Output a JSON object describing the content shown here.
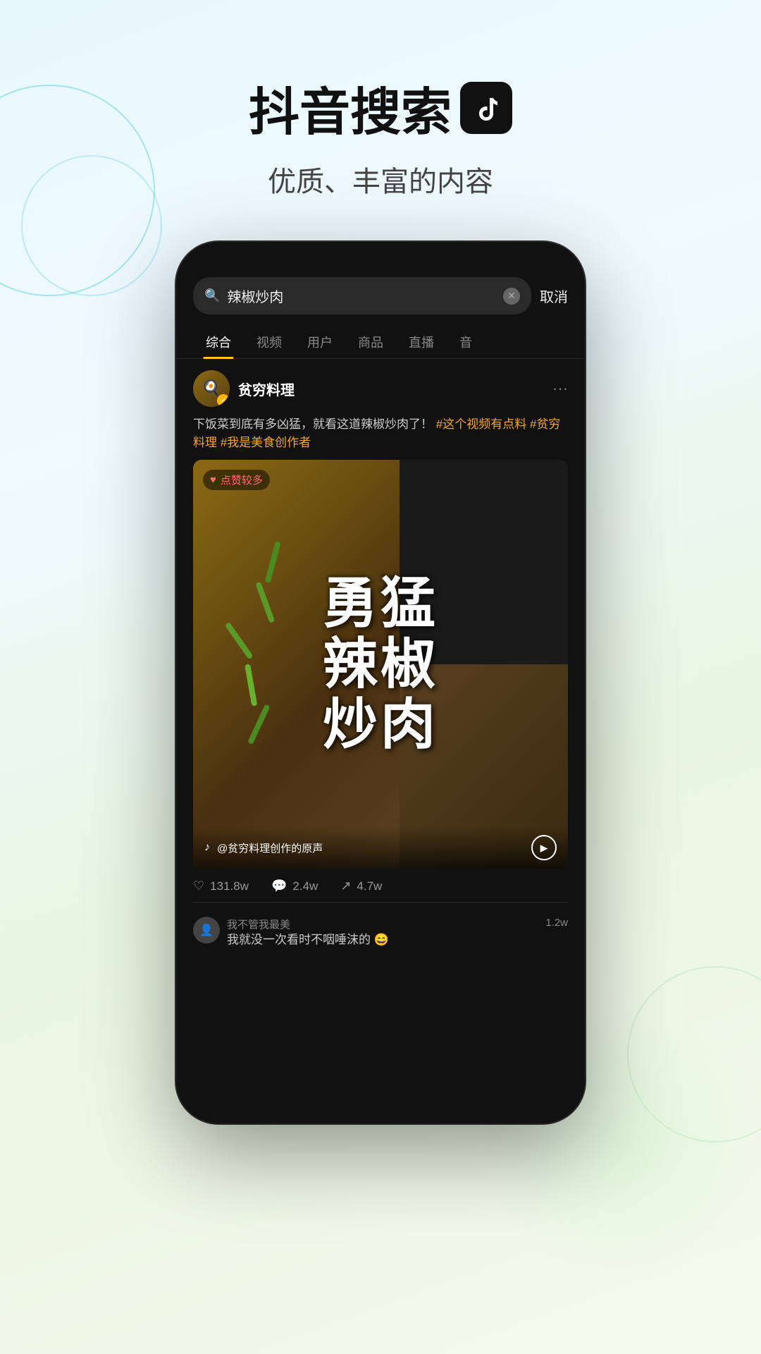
{
  "header": {
    "main_title": "抖音搜索",
    "subtitle": "优质、丰富的内容",
    "logo_emoji": "♪"
  },
  "phone": {
    "search": {
      "query": "辣椒炒肉",
      "cancel_label": "取消"
    },
    "tabs": [
      {
        "label": "综合",
        "active": true
      },
      {
        "label": "视频",
        "active": false
      },
      {
        "label": "用户",
        "active": false
      },
      {
        "label": "商品",
        "active": false
      },
      {
        "label": "直播",
        "active": false
      },
      {
        "label": "音",
        "active": false
      }
    ],
    "post": {
      "author": "贫穷料理",
      "text_part1": "下饭菜到底有多凶猛，就看这道辣椒炒肉了！",
      "hashtags": "#这个视频有点料 #贫穷料理 #我是美食创作者",
      "badge": "点赞较多",
      "video_text": "勇\n猛\n辣\n椒\n炒\n肉",
      "audio_label": "@贫穷料理创作的原声",
      "stats": {
        "likes": "131.8w",
        "comments": "2.4w",
        "shares": "4.7w"
      }
    },
    "comments": [
      {
        "user": "我不管我最美",
        "text": "我就没一次看时不咽唾沫的 😄",
        "count": "1.2w"
      }
    ]
  }
}
